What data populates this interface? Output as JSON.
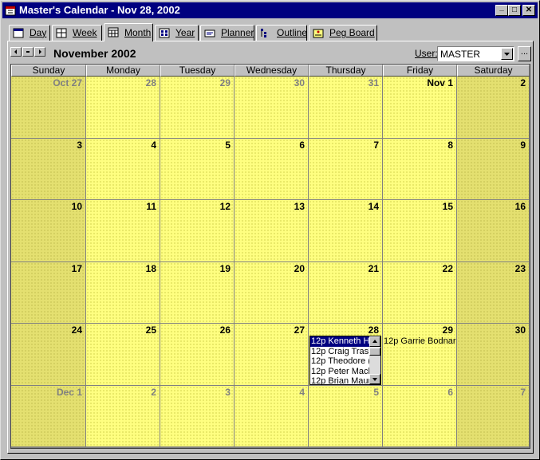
{
  "window": {
    "title": "Master's Calendar - Nov 28, 2002"
  },
  "title_buttons": {
    "minimize": "_",
    "maximize": "□",
    "close": "✕"
  },
  "tabs": [
    {
      "label": "Day"
    },
    {
      "label": "Week"
    },
    {
      "label": "Month"
    },
    {
      "label": "Year"
    },
    {
      "label": "Planner"
    },
    {
      "label": "Outline"
    },
    {
      "label": "Peg Board"
    }
  ],
  "header": {
    "month_title": "November 2002",
    "user_label": "User:",
    "user_value": "MASTER",
    "dots": "..."
  },
  "day_headers": [
    "Sunday",
    "Monday",
    "Tuesday",
    "Wednesday",
    "Thursday",
    "Friday",
    "Saturday"
  ],
  "weeks": [
    [
      {
        "label": "Oct 27",
        "dim": true
      },
      {
        "label": "28",
        "dim": true
      },
      {
        "label": "29",
        "dim": true
      },
      {
        "label": "30",
        "dim": true
      },
      {
        "label": "31",
        "dim": true
      },
      {
        "label": "Nov 1",
        "dim": false
      },
      {
        "label": "2",
        "dim": false
      }
    ],
    [
      {
        "label": "3"
      },
      {
        "label": "4"
      },
      {
        "label": "5"
      },
      {
        "label": "6"
      },
      {
        "label": "7"
      },
      {
        "label": "8"
      },
      {
        "label": "9"
      }
    ],
    [
      {
        "label": "10"
      },
      {
        "label": "11"
      },
      {
        "label": "12"
      },
      {
        "label": "13"
      },
      {
        "label": "14"
      },
      {
        "label": "15"
      },
      {
        "label": "16"
      }
    ],
    [
      {
        "label": "17"
      },
      {
        "label": "18"
      },
      {
        "label": "19"
      },
      {
        "label": "20"
      },
      {
        "label": "21"
      },
      {
        "label": "22"
      },
      {
        "label": "23"
      }
    ],
    [
      {
        "label": "24"
      },
      {
        "label": "25"
      },
      {
        "label": "26"
      },
      {
        "label": "27"
      },
      {
        "label": "28"
      },
      {
        "label": "29"
      },
      {
        "label": "30"
      }
    ],
    [
      {
        "label": "Dec 1",
        "dim": true
      },
      {
        "label": "2",
        "dim": true
      },
      {
        "label": "3",
        "dim": true
      },
      {
        "label": "4",
        "dim": true
      },
      {
        "label": "5",
        "dim": true
      },
      {
        "label": "6",
        "dim": true
      },
      {
        "label": "7",
        "dim": true
      }
    ]
  ],
  "events": {
    "nov28": [
      "12p Kenneth H",
      "12p Craig Trask",
      "12p Theodore (",
      "12p Peter Macl",
      "12p Brian Maur"
    ],
    "nov29": [
      "12p Garrie Bodnar"
    ]
  },
  "colors": {
    "titlebar": "#000080",
    "weekday_cell": "#ffff80",
    "weekend_cell": "#e4e070",
    "selection": "#000080"
  }
}
